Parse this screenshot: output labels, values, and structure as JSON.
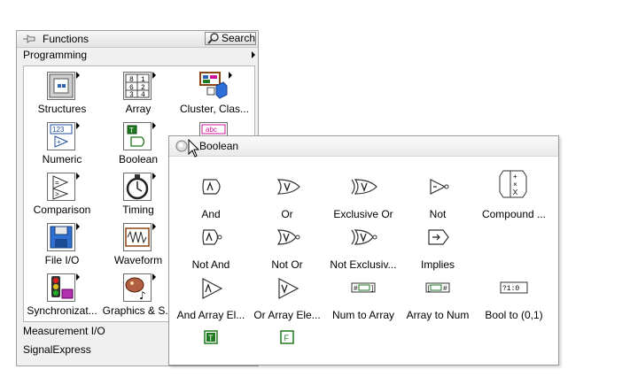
{
  "functions_palette": {
    "title": "Functions",
    "search_label": "Search",
    "category_programming": "Programming",
    "items": [
      {
        "label": "Structures",
        "icon": "structures-icon"
      },
      {
        "label": "Array",
        "icon": "array-icon"
      },
      {
        "label": "Cluster, Clas...",
        "icon": "cluster-class-icon"
      },
      {
        "label": "Numeric",
        "icon": "numeric-icon"
      },
      {
        "label": "Boolean",
        "icon": "boolean-icon"
      },
      {
        "label": "",
        "icon": "string-icon"
      },
      {
        "label": "Comparison",
        "icon": "comparison-icon"
      },
      {
        "label": "Timing",
        "icon": "timing-icon"
      },
      {
        "label": "",
        "icon": ""
      },
      {
        "label": "File I/O",
        "icon": "file-io-icon"
      },
      {
        "label": "Waveform",
        "icon": "waveform-icon"
      },
      {
        "label": "",
        "icon": ""
      },
      {
        "label": "Synchronizat...",
        "icon": "synchronization-icon"
      },
      {
        "label": "Graphics & S...",
        "icon": "graphics-sound-icon"
      }
    ],
    "category_measurement": "Measurement I/O",
    "category_signalexpress": "SignalExpress",
    "icon_text": {
      "numeric": "123",
      "string": "abc",
      "array_cells": [
        "8",
        "1",
        "2",
        "6",
        "3",
        "4"
      ]
    }
  },
  "boolean_palette": {
    "title": "Boolean",
    "items": [
      {
        "label": "And",
        "icon": "and-gate-icon"
      },
      {
        "label": "Or",
        "icon": "or-gate-icon"
      },
      {
        "label": "Exclusive Or",
        "icon": "xor-gate-icon"
      },
      {
        "label": "Not",
        "icon": "not-gate-icon"
      },
      {
        "label": "Compound ...",
        "icon": "compound-arithmetic-icon"
      },
      {
        "label": "Not And",
        "icon": "nand-gate-icon"
      },
      {
        "label": "Not Or",
        "icon": "nor-gate-icon"
      },
      {
        "label": "Not Exclusiv...",
        "icon": "xnor-gate-icon"
      },
      {
        "label": "Implies",
        "icon": "implies-icon"
      },
      {
        "label": "And Array El...",
        "icon": "and-array-icon"
      },
      {
        "label": "Or Array Ele...",
        "icon": "or-array-icon"
      },
      {
        "label": "Num to Array",
        "icon": "num-to-array-icon"
      },
      {
        "label": "Array to Num",
        "icon": "array-to-num-icon"
      },
      {
        "label": "Bool to (0,1)",
        "icon": "bool-to-01-icon"
      },
      {
        "label": "",
        "icon": "true-constant-icon"
      },
      {
        "label": "",
        "icon": "false-constant-icon"
      }
    ],
    "icon_text": {
      "true": "T",
      "false": "F",
      "bool_to_01": "?1:0"
    }
  },
  "colors": {
    "boolean_green": "#1f7a1f",
    "string_pink": "#d0149c",
    "cluster_brown": "#8b4513"
  }
}
